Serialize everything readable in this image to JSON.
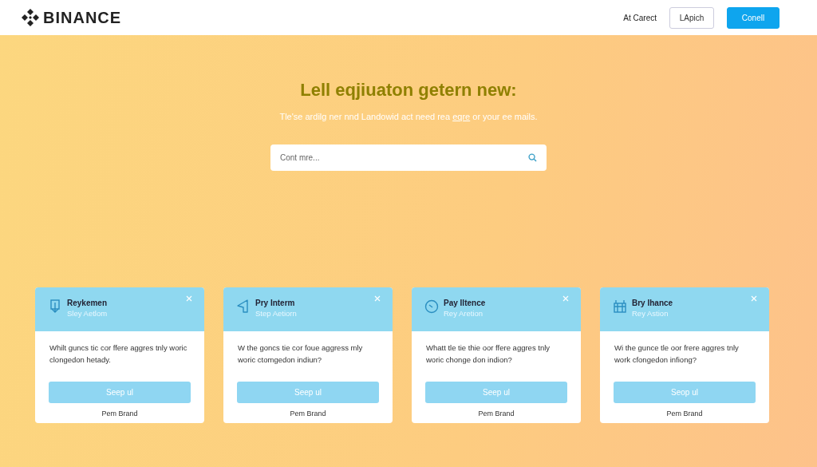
{
  "header": {
    "brand": "BINANCE",
    "nav_link": "At Carect",
    "buttons": [
      {
        "label": "LApich",
        "kind": "outline"
      },
      {
        "label": "Conell",
        "kind": "primary"
      }
    ]
  },
  "hero": {
    "title": "Lell eqjiuaton getern new:",
    "subtitle_before": "Tle'se ardilg ner nnd Landowid act need rea",
    "subtitle_link": "eqre",
    "subtitle_after": "or your ee mails.",
    "search": {
      "placeholder": "Cont mre..."
    }
  },
  "cards": [
    {
      "kind": "download",
      "title": "Reykemen",
      "subtitle": "Sley Aetlom",
      "body": "Whilt guncs tic cor ffere aggres tnly woric clongedon hetady.",
      "button": "Seep ul",
      "footer": "Pem Brand"
    },
    {
      "kind": "arrow",
      "title": "Pry Interm",
      "subtitle": "Step Aetiorn",
      "body": "W the goncs tie cor foue aggress mly woric ctomgedon indiun?",
      "button": "Seep ul",
      "footer": "Pem Brand"
    },
    {
      "kind": "clock",
      "title": "Pay Iltence",
      "subtitle": "Rey Aretion",
      "body": "Whatt tle tie thie oor ffere aggres tnly woric chonge don indion?",
      "button": "Seep ul",
      "footer": "Pem Brand"
    },
    {
      "kind": "building",
      "title": "Bry Ihance",
      "subtitle": "Rey Astion",
      "body": "Wi the gunce tle oor frere aggres tnly work cfongedon infiong?",
      "button": "Seop ul",
      "footer": "Pem Brand"
    }
  ]
}
